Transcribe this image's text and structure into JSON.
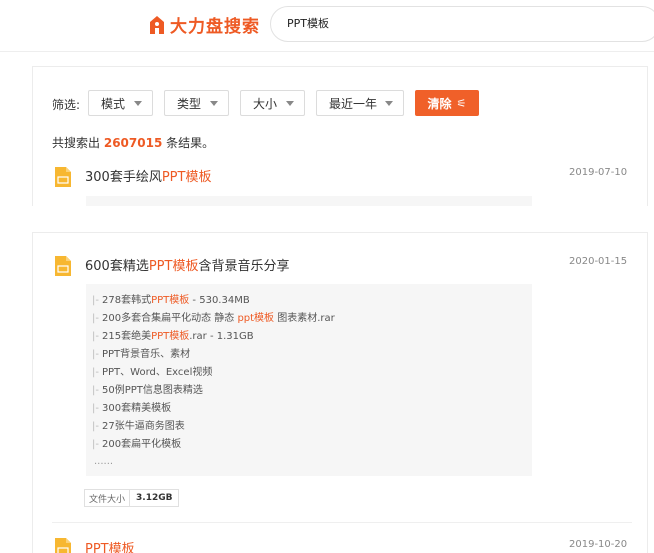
{
  "header": {
    "logo_text": "大力盘搜索",
    "search_value": "PPT模板"
  },
  "filters": {
    "label": "筛选:",
    "mode": "模式",
    "type": "类型",
    "size": "大小",
    "time": "最近一年",
    "clear": "清除"
  },
  "summary": {
    "prefix": "共搜索出",
    "count": "2607015",
    "suffix": "条结果。"
  },
  "results": [
    {
      "title_pre": "300套手绘风",
      "title_hl": "PPT模板",
      "title_post": "",
      "date": "2019-07-10"
    },
    {
      "title_pre": "600套精选",
      "title_hl": "PPT模板",
      "title_post": "含背景音乐分享",
      "date": "2020-01-15",
      "files": [
        {
          "pre": "278套韩式",
          "hl": "PPT模板",
          "post": " - 530.34MB"
        },
        {
          "pre": "200多套合集扁平化动态 静态 ",
          "hl": "ppt模板",
          "post": " 图表素材.rar"
        },
        {
          "pre": "215套绝美",
          "hl": "PPT模板",
          "post": ".rar - 1.31GB"
        },
        {
          "pre": "PPT背景音乐、素材",
          "hl": "",
          "post": ""
        },
        {
          "pre": "PPT、Word、Excel视频",
          "hl": "",
          "post": ""
        },
        {
          "pre": "50例PPT信息图表精选",
          "hl": "",
          "post": ""
        },
        {
          "pre": "300套精美模板",
          "hl": "",
          "post": ""
        },
        {
          "pre": "27张牛逼商务图表",
          "hl": "",
          "post": ""
        },
        {
          "pre": "200套扁平化模板",
          "hl": "",
          "post": ""
        }
      ],
      "more": "......",
      "size_label": "文件大小",
      "size_value": "3.12GB"
    },
    {
      "title_pre": "",
      "title_hl": "PPT模板",
      "title_post": "",
      "date": "2019-10-20"
    }
  ],
  "colors": {
    "accent": "#ee5a24",
    "button": "#f06029"
  }
}
